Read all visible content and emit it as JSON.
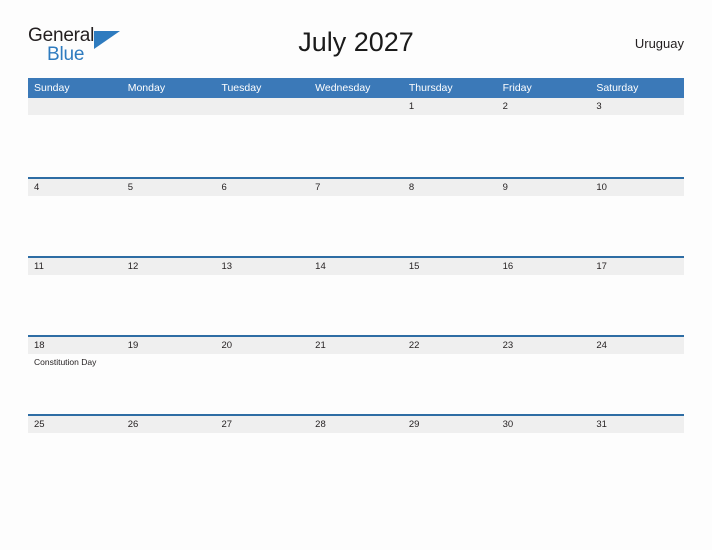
{
  "header": {
    "logo": {
      "word_dark": "General",
      "word_blue": "Blue",
      "triangle_icon": "triangle-icon",
      "brand_color": "#2e7bbf"
    },
    "title": "July 2027",
    "country": "Uruguay"
  },
  "calendar": {
    "month": "July",
    "year": "2027",
    "weekday_headers": [
      "Sunday",
      "Monday",
      "Tuesday",
      "Wednesday",
      "Thursday",
      "Friday",
      "Saturday"
    ],
    "header_bg_color": "#3b79b8",
    "header_text_color": "#ffffff",
    "row_divider_color": "#2e6da4",
    "daynum_band_color": "#efefef",
    "weeks": [
      {
        "days": [
          {
            "num": "",
            "events": []
          },
          {
            "num": "",
            "events": []
          },
          {
            "num": "",
            "events": []
          },
          {
            "num": "",
            "events": []
          },
          {
            "num": "1",
            "events": []
          },
          {
            "num": "2",
            "events": []
          },
          {
            "num": "3",
            "events": []
          }
        ]
      },
      {
        "days": [
          {
            "num": "4",
            "events": []
          },
          {
            "num": "5",
            "events": []
          },
          {
            "num": "6",
            "events": []
          },
          {
            "num": "7",
            "events": []
          },
          {
            "num": "8",
            "events": []
          },
          {
            "num": "9",
            "events": []
          },
          {
            "num": "10",
            "events": []
          }
        ]
      },
      {
        "days": [
          {
            "num": "11",
            "events": []
          },
          {
            "num": "12",
            "events": []
          },
          {
            "num": "13",
            "events": []
          },
          {
            "num": "14",
            "events": []
          },
          {
            "num": "15",
            "events": []
          },
          {
            "num": "16",
            "events": []
          },
          {
            "num": "17",
            "events": []
          }
        ]
      },
      {
        "days": [
          {
            "num": "18",
            "events": [
              "Constitution Day"
            ]
          },
          {
            "num": "19",
            "events": []
          },
          {
            "num": "20",
            "events": []
          },
          {
            "num": "21",
            "events": []
          },
          {
            "num": "22",
            "events": []
          },
          {
            "num": "23",
            "events": []
          },
          {
            "num": "24",
            "events": []
          }
        ]
      },
      {
        "days": [
          {
            "num": "25",
            "events": []
          },
          {
            "num": "26",
            "events": []
          },
          {
            "num": "27",
            "events": []
          },
          {
            "num": "28",
            "events": []
          },
          {
            "num": "29",
            "events": []
          },
          {
            "num": "30",
            "events": []
          },
          {
            "num": "31",
            "events": []
          }
        ]
      }
    ]
  }
}
